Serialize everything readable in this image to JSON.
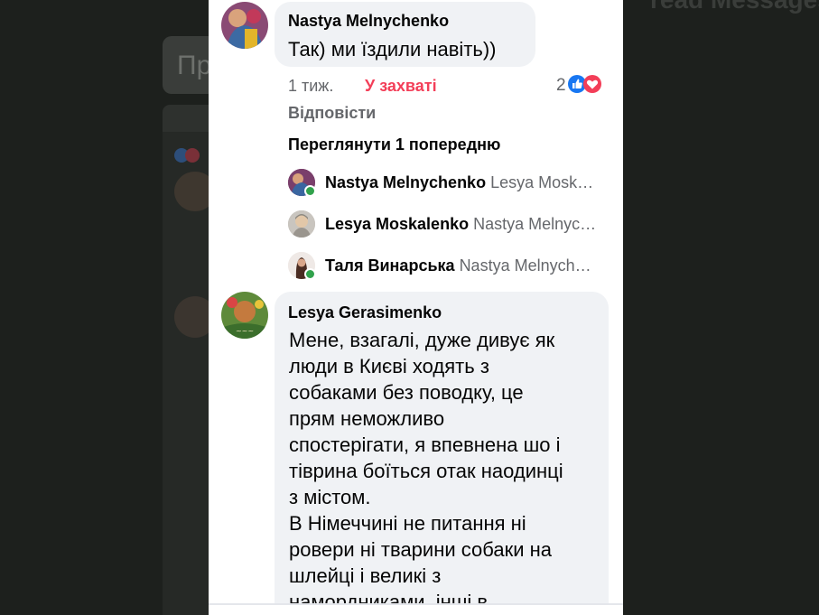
{
  "background": {
    "partial_card_text": "Пр",
    "partial_header_text": "read Messages"
  },
  "comment1": {
    "author": "Nastya Melnychenko",
    "text": "Так) ми їздили навіть))",
    "time": "1 тиж.",
    "reaction_label": "У захваті",
    "reaction_count": "2",
    "reply_action": "Відповісти",
    "view_previous": "Переглянути 1 попередню"
  },
  "replies": [
    {
      "author": "Nastya Melnychenko",
      "preview": "Lesya Mosk…",
      "online": true
    },
    {
      "author": "Lesya Moskalenko",
      "preview": "Nastya Melnyc…",
      "online": false
    },
    {
      "author": "Таля Винарська",
      "preview": "Nastya Melnych…",
      "online": true
    }
  ],
  "comment2": {
    "author": "Lesya Gerasimenko",
    "text_lines": [
      "Мене, взагалі, дуже дивує як",
      "люди в Києві ходять з",
      "собаками без поводку, це",
      "прям неможливо",
      "спостерігати, я впевнена шо і",
      "тіврина боїться отак наодинці",
      "з містом.",
      "В Німеччині не питання ні",
      "ровери ні тварини собаки на",
      "шлейці і великі з",
      "намордниками, інші в"
    ]
  },
  "colors": {
    "love_accent": "#f33e58",
    "like_blue": "#1877f2",
    "online_green": "#31a24c",
    "bubble_bg": "#f0f2f5"
  },
  "icons": {
    "like": "like-icon",
    "love": "love-icon"
  }
}
